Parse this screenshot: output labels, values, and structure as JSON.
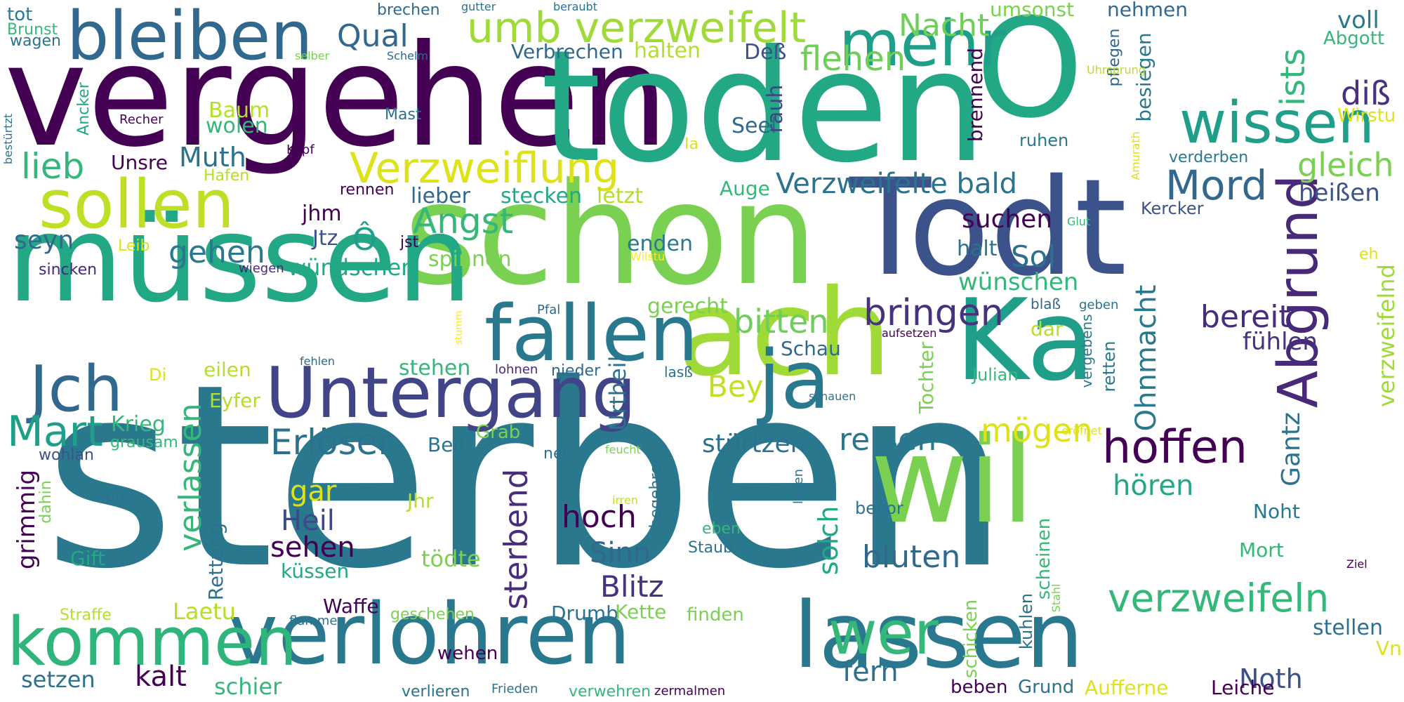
{
  "palette": {
    "dark_purple": "#440154",
    "purple": "#482878",
    "indigo": "#3e4989",
    "blue": "#31688e",
    "teal_blue": "#26828e",
    "teal": "#1f9e89",
    "green_teal": "#35b779",
    "green": "#6ece58",
    "lime": "#b5de2b",
    "yellow": "#fde725"
  },
  "words": [
    {
      "text": "sterben",
      "color": "#2a788e"
    },
    {
      "text": "vergehen",
      "color": "#440154"
    },
    {
      "text": "toden",
      "color": "#22a884"
    },
    {
      "text": "schon",
      "color": "#7ad151"
    },
    {
      "text": "Todt",
      "color": "#3b528b"
    },
    {
      "text": "müssen",
      "color": "#22a884"
    },
    {
      "text": "O",
      "color": "#22a884"
    },
    {
      "text": "ach",
      "color": "#a0da39"
    },
    {
      "text": "Ka",
      "color": "#1f9e89"
    },
    {
      "text": "wil",
      "color": "#7ad151"
    },
    {
      "text": "verlohren",
      "color": "#2a788e"
    },
    {
      "text": "lassen",
      "color": "#2a788e"
    },
    {
      "text": "Untergang",
      "color": "#414487"
    },
    {
      "text": "fallen",
      "color": "#2a788e"
    },
    {
      "text": "ja",
      "color": "#2a788e"
    },
    {
      "text": "kommen",
      "color": "#2fb47c"
    },
    {
      "text": "bleiben",
      "color": "#31688e"
    },
    {
      "text": "mehr",
      "color": "#1f9e89"
    },
    {
      "text": "sollen",
      "color": "#bddf26"
    },
    {
      "text": "wissen",
      "color": "#1f9e89"
    },
    {
      "text": "Abgrund",
      "color": "#482878"
    },
    {
      "text": "Jch",
      "color": "#31688e"
    },
    {
      "text": "wer",
      "color": "#35b779"
    },
    {
      "text": "umb verzweifelt",
      "color": "#a0da39"
    },
    {
      "text": "Verzweiflung",
      "color": "#dde318"
    },
    {
      "text": "Mart",
      "color": "#1f9e89"
    },
    {
      "text": "hoffen",
      "color": "#440154"
    },
    {
      "text": "Angst",
      "color": "#35b779"
    },
    {
      "text": "Erlöser",
      "color": "#2c728e"
    },
    {
      "text": "verzweifeln",
      "color": "#35b779"
    },
    {
      "text": "Mord",
      "color": "#31688e"
    },
    {
      "text": "bringen",
      "color": "#46327e"
    },
    {
      "text": "Verzweifelte bald",
      "color": "#2c728e"
    },
    {
      "text": "ists",
      "color": "#35b779"
    },
    {
      "text": "diß",
      "color": "#46327e"
    },
    {
      "text": "flehen",
      "color": "#6ece58"
    },
    {
      "text": "Nacht",
      "color": "#6ece58"
    },
    {
      "text": "Qual",
      "color": "#31688e"
    },
    {
      "text": "lieb",
      "color": "#35b779"
    },
    {
      "text": "gleich",
      "color": "#7ad151"
    },
    {
      "text": "Muth",
      "color": "#2c728e"
    },
    {
      "text": "Ohnmacht",
      "color": "#2a788e"
    },
    {
      "text": "sterbend",
      "color": "#472d7b"
    },
    {
      "text": "bitten",
      "color": "#6ece58"
    },
    {
      "text": "bereit",
      "color": "#472d7b"
    },
    {
      "text": "verlassen",
      "color": "#35b779"
    },
    {
      "text": "gehen",
      "color": "#2a788e"
    },
    {
      "text": "suchen",
      "color": "#440154"
    },
    {
      "text": "Sol",
      "color": "#2c728e"
    },
    {
      "text": "hoch",
      "color": "#440154"
    },
    {
      "text": "Blitz",
      "color": "#46327e"
    },
    {
      "text": "bluten",
      "color": "#31688e"
    },
    {
      "text": "reißen",
      "color": "#2a788e"
    },
    {
      "text": "mögen",
      "color": "#dde318"
    },
    {
      "text": "Bey",
      "color": "#c2df23"
    },
    {
      "text": "Gantz",
      "color": "#2c728e"
    },
    {
      "text": "Heil",
      "color": "#3e4989"
    },
    {
      "text": "sehen",
      "color": "#440154"
    },
    {
      "text": "solch",
      "color": "#22a884"
    },
    {
      "text": "Sinn",
      "color": "#31688e"
    },
    {
      "text": "stürtzen",
      "color": "#2c728e"
    },
    {
      "text": "fern",
      "color": "#2c728e"
    },
    {
      "text": "kalt",
      "color": "#440154"
    },
    {
      "text": "hören",
      "color": "#22a884"
    },
    {
      "text": "Noth",
      "color": "#3b528b"
    },
    {
      "text": "grimmig",
      "color": "#440154"
    },
    {
      "text": "seyn",
      "color": "#31688e"
    },
    {
      "text": "Urtheil",
      "color": "#2c728e"
    },
    {
      "text": "verzweifelnd",
      "color": "#a0da39"
    },
    {
      "text": "fühlen",
      "color": "#46327e"
    },
    {
      "text": "heißen",
      "color": "#3b528b"
    },
    {
      "text": "voll",
      "color": "#2a788e"
    },
    {
      "text": "Abgott",
      "color": "#35b779"
    },
    {
      "text": "Wirstu",
      "color": "#dde318"
    },
    {
      "text": "wünschen",
      "color": "#35b779"
    },
    {
      "text": "wündschen",
      "color": "#22a884"
    },
    {
      "text": "gerecht",
      "color": "#7ad151"
    },
    {
      "text": "Krieg",
      "color": "#35b779"
    },
    {
      "text": "Ô",
      "color": "#1f9e89"
    },
    {
      "text": "Deß",
      "color": "#3b528b"
    },
    {
      "text": "halten",
      "color": "#b5de2b"
    },
    {
      "text": "Verbrechen",
      "color": "#31688e"
    },
    {
      "text": "umsonst",
      "color": "#7ad151"
    },
    {
      "text": "nehmen",
      "color": "#31688e"
    },
    {
      "text": "stecken",
      "color": "#22a884"
    },
    {
      "text": "letzt",
      "color": "#b5de2b"
    },
    {
      "text": "lieber",
      "color": "#31688e"
    },
    {
      "text": "Auge",
      "color": "#35b779"
    },
    {
      "text": "Seel",
      "color": "#31688e"
    },
    {
      "text": "rauh",
      "color": "#414487"
    },
    {
      "text": "brennend",
      "color": "#440154"
    },
    {
      "text": "besiegen",
      "color": "#2a788e"
    },
    {
      "text": "pflegen",
      "color": "#31688e"
    },
    {
      "text": "ruhen",
      "color": "#2a788e"
    },
    {
      "text": "verderben",
      "color": "#2a788e"
    },
    {
      "text": "Kercker",
      "color": "#3b528b"
    },
    {
      "text": "halt",
      "color": "#2c728e"
    },
    {
      "text": "enden",
      "color": "#2a788e"
    },
    {
      "text": "spinnen",
      "color": "#7ad151"
    },
    {
      "text": "jst",
      "color": "#440154"
    },
    {
      "text": "Jtz",
      "color": "#3b528b"
    },
    {
      "text": "jhm",
      "color": "#440154"
    },
    {
      "text": "Leib",
      "color": "#dde318"
    },
    {
      "text": "wiegen",
      "color": "#482878"
    },
    {
      "text": "rennen",
      "color": "#440154"
    },
    {
      "text": "Unsre",
      "color": "#440154"
    },
    {
      "text": "Hafen",
      "color": "#b5de2b"
    },
    {
      "text": "Baum",
      "color": "#b5de2b"
    },
    {
      "text": "wolen",
      "color": "#35b779"
    },
    {
      "text": "Mast",
      "color": "#2c728e"
    },
    {
      "text": "Kopf",
      "color": "#440154"
    },
    {
      "text": "Recher",
      "color": "#440154"
    },
    {
      "text": "Ancker",
      "color": "#22a884"
    },
    {
      "text": "bestürtzt",
      "color": "#2c728e"
    },
    {
      "text": "tot",
      "color": "#2a788e"
    },
    {
      "text": "Brunst",
      "color": "#35b779"
    },
    {
      "text": "wagen",
      "color": "#2c728e"
    },
    {
      "text": "selber",
      "color": "#7ad151"
    },
    {
      "text": "Schelm",
      "color": "#31688e"
    },
    {
      "text": "brechen",
      "color": "#31688e"
    },
    {
      "text": "gutter",
      "color": "#2c728e"
    },
    {
      "text": "beraubt",
      "color": "#2c728e"
    },
    {
      "text": "Uhrsprung",
      "color": "#b5de2b"
    },
    {
      "text": "Ia",
      "color": "#dde318"
    },
    {
      "text": "Amurath",
      "color": "#dde318"
    },
    {
      "text": "Glut",
      "color": "#35b779"
    },
    {
      "text": "Wilstu",
      "color": "#fde725"
    },
    {
      "text": "eh",
      "color": "#dde318"
    },
    {
      "text": "sincken",
      "color": "#482878"
    },
    {
      "text": "Pfal",
      "color": "#31688e"
    },
    {
      "text": "stumm",
      "color": "#fde725"
    },
    {
      "text": "aufsetzen",
      "color": "#440154"
    },
    {
      "text": "Schau",
      "color": "#31688e"
    },
    {
      "text": "blaß",
      "color": "#31688e"
    },
    {
      "text": "geben",
      "color": "#2c728e"
    },
    {
      "text": "dar",
      "color": "#b5de2b"
    },
    {
      "text": "vergebens",
      "color": "#2a788e"
    },
    {
      "text": "retten",
      "color": "#2a788e"
    },
    {
      "text": "Tochter",
      "color": "#7ad151"
    },
    {
      "text": "Julian",
      "color": "#35b779"
    },
    {
      "text": "lasß",
      "color": "#2c728e"
    },
    {
      "text": "nieder",
      "color": "#31688e"
    },
    {
      "text": "lohnen",
      "color": "#482878"
    },
    {
      "text": "stehen",
      "color": "#35b779"
    },
    {
      "text": "eilen",
      "color": "#b5de2b"
    },
    {
      "text": "Di",
      "color": "#dde318"
    },
    {
      "text": "fehlen",
      "color": "#31688e"
    },
    {
      "text": "Eyfer",
      "color": "#b5de2b"
    },
    {
      "text": "schauen",
      "color": "#2c728e"
    },
    {
      "text": "eröfnet",
      "color": "#dde318"
    },
    {
      "text": "Grab",
      "color": "#7ad151"
    },
    {
      "text": "Beil",
      "color": "#2c728e"
    },
    {
      "text": "nein",
      "color": "#2c728e"
    },
    {
      "text": "feucht",
      "color": "#7ad151"
    },
    {
      "text": "wohlan",
      "color": "#3b528b"
    },
    {
      "text": "grausam",
      "color": "#35b779"
    },
    {
      "text": "dahin",
      "color": "#7ad151"
    },
    {
      "text": "Blut",
      "color": "#2c728e"
    },
    {
      "text": "gar",
      "color": "#dde318"
    },
    {
      "text": "Jhr",
      "color": "#b5de2b"
    },
    {
      "text": "irren",
      "color": "#c2df23"
    },
    {
      "text": "begehren",
      "color": "#2c728e"
    },
    {
      "text": "legen",
      "color": "#2c728e"
    },
    {
      "text": "bevor",
      "color": "#2c728e"
    },
    {
      "text": "eben",
      "color": "#35b779"
    },
    {
      "text": "Staub",
      "color": "#2c728e"
    },
    {
      "text": "scheinen",
      "color": "#35b779"
    },
    {
      "text": "Stahl",
      "color": "#7ad151"
    },
    {
      "text": "Noht",
      "color": "#2a788e"
    },
    {
      "text": "Mort",
      "color": "#35b779"
    },
    {
      "text": "Ziel",
      "color": "#440154"
    },
    {
      "text": "Gift",
      "color": "#22a884"
    },
    {
      "text": "Rettung",
      "color": "#2c728e"
    },
    {
      "text": "küssen",
      "color": "#22a884"
    },
    {
      "text": "tödte",
      "color": "#7ad151"
    },
    {
      "text": "Straffe",
      "color": "#b5de2b"
    },
    {
      "text": "flammen",
      "color": "#2c728e"
    },
    {
      "text": "Waffe",
      "color": "#440154"
    },
    {
      "text": "Laetu",
      "color": "#b5de2b"
    },
    {
      "text": "geschehen",
      "color": "#7ad151"
    },
    {
      "text": "Drumb",
      "color": "#2c728e"
    },
    {
      "text": "Kette",
      "color": "#7ad151"
    },
    {
      "text": "finden",
      "color": "#7ad151"
    },
    {
      "text": "kühlen",
      "color": "#2c728e"
    },
    {
      "text": "schicken",
      "color": "#7ad151"
    },
    {
      "text": "stellen",
      "color": "#2c728e"
    },
    {
      "text": "Vn",
      "color": "#dde318"
    },
    {
      "text": "setzen",
      "color": "#2c728e"
    },
    {
      "text": "schier",
      "color": "#35b779"
    },
    {
      "text": "wehen",
      "color": "#440154"
    },
    {
      "text": "verlieren",
      "color": "#2c728e"
    },
    {
      "text": "Frieden",
      "color": "#2c728e"
    },
    {
      "text": "verwehren",
      "color": "#35b779"
    },
    {
      "text": "zermalmen",
      "color": "#440154"
    },
    {
      "text": "beben",
      "color": "#440154"
    },
    {
      "text": "Grund",
      "color": "#2c728e"
    },
    {
      "text": "Aufferne",
      "color": "#dde318"
    },
    {
      "text": "Leiche",
      "color": "#440154"
    }
  ]
}
